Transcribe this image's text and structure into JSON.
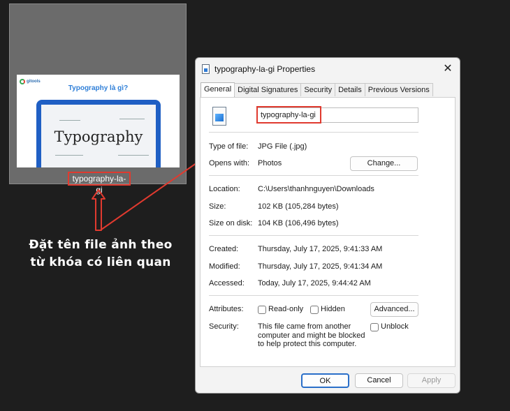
{
  "thumbnail": {
    "logo_text": "gitools",
    "headline": "Typography là gì?",
    "laptop_word": "Typography",
    "file_label": "typography-la-gi"
  },
  "annotation": {
    "line1": "Đặt tên file ảnh theo",
    "line2": "từ khóa có liên quan"
  },
  "annotation_color": "#e03a2f",
  "dialog": {
    "title": "typography-la-gi Properties",
    "close_glyph": "✕",
    "tabs": [
      "General",
      "Digital Signatures",
      "Security",
      "Details",
      "Previous Versions"
    ],
    "file_name_value": "typography-la-gi",
    "type_label": "Type of file:",
    "type_value": "JPG File (.jpg)",
    "opens_label": "Opens with:",
    "opens_value": "Photos",
    "change_button": "Change...",
    "location_label": "Location:",
    "location_value": "C:\\Users\\thanhnguyen\\Downloads",
    "size_label": "Size:",
    "size_value": "102 KB (105,284 bytes)",
    "size_on_disk_label": "Size on disk:",
    "size_on_disk_value": "104 KB (106,496 bytes)",
    "created_label": "Created:",
    "created_value": "Thursday, July 17, 2025, 9:41:33 AM",
    "modified_label": "Modified:",
    "modified_value": "Thursday, July 17, 2025, 9:41:34 AM",
    "accessed_label": "Accessed:",
    "accessed_value": "Today, July 17, 2025, 9:44:42 AM",
    "attributes_label": "Attributes:",
    "readonly_label": "Read-only",
    "hidden_label": "Hidden",
    "advanced_button": "Advanced...",
    "security_label": "Security:",
    "security_text": "This file came from another computer and might be blocked to help protect this computer.",
    "unblock_label": "Unblock",
    "ok_button": "OK",
    "cancel_button": "Cancel",
    "apply_button": "Apply"
  }
}
